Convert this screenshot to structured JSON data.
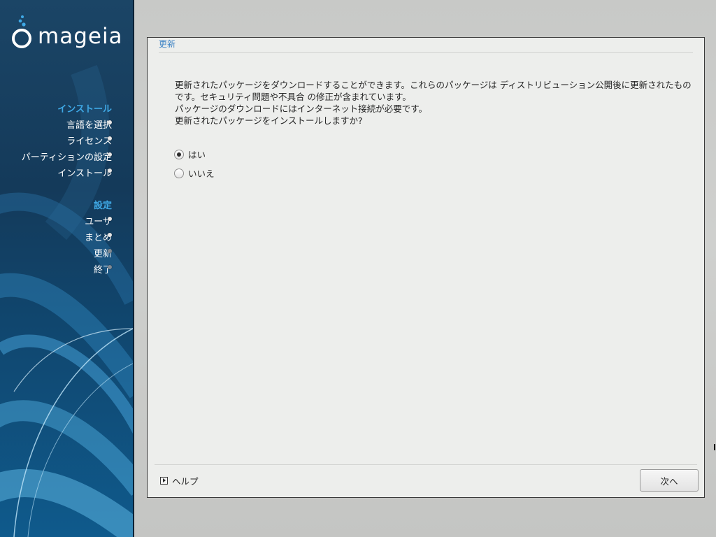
{
  "sidebar": {
    "logo_text": "mageia",
    "sections": [
      {
        "title": "インストール",
        "items": [
          {
            "label": "言語を選択",
            "state": "done"
          },
          {
            "label": "ライセンス",
            "state": "done"
          },
          {
            "label": "パーティションの設定",
            "state": "done"
          },
          {
            "label": "インストール",
            "state": "done"
          }
        ]
      },
      {
        "title": "設定",
        "items": [
          {
            "label": "ユーザ",
            "state": "done"
          },
          {
            "label": "まとめ",
            "state": "done"
          },
          {
            "label": "更新",
            "state": "current"
          },
          {
            "label": "終了",
            "state": "pending"
          }
        ]
      }
    ]
  },
  "panel": {
    "title": "更新",
    "description": [
      "更新されたパッケージをダウンロードすることができます。これらのパッケージは ディストリビューション公開後に更新されたものです。セキュリティ問題や不具合 の修正が含まれています。",
      "パッケージのダウンロードにはインターネット接続が必要です。",
      "更新されたパッケージをインストールしますか?"
    ],
    "options": [
      {
        "label": "はい",
        "selected": true
      },
      {
        "label": "いいえ",
        "selected": false
      }
    ],
    "help_label": "ヘルプ",
    "next_label": "次へ"
  },
  "colors": {
    "section_title": "#3fa9e6",
    "panel_title": "#3b82c4",
    "sidebar_bg": "#143a5a"
  }
}
